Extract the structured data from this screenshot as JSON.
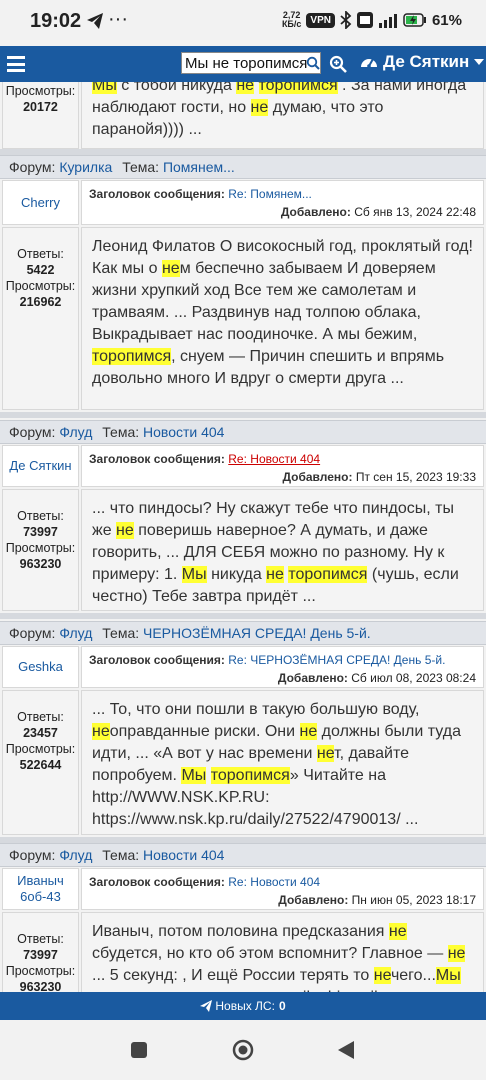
{
  "status_bar": {
    "time": "19:02",
    "speed_value": "2,72",
    "speed_unit": "КБ/с",
    "vpn": "VPN",
    "battery": "61%"
  },
  "header": {
    "search_value": "Мы не торопимся",
    "username": "Де Сяткин"
  },
  "labels": {
    "forum": "Форум:",
    "topic": "Тема:",
    "subject": "Заголовок сообщения:",
    "added": "Добавлено:",
    "replies": "Ответы:",
    "views": "Просмотры:"
  },
  "first_partial": {
    "views_label": "Просмотры:",
    "views": "20172"
  },
  "posts": [
    {
      "forum": "Курилка",
      "topic": "Помянем...",
      "author": "Cherry",
      "subject": "Re: Помянем...",
      "date": "Сб янв 13, 2024 22:48",
      "replies": "5422",
      "views": "216962"
    },
    {
      "forum": "Флуд",
      "topic": "Новости 404",
      "author": "Де Сяткин",
      "subject": "Re: Новости 404",
      "date": "Пт сен 15, 2023 19:33",
      "replies": "73997",
      "views": "963230"
    },
    {
      "forum": "Флуд",
      "topic": "ЧЕРНОЗЁМНАЯ СРЕДА! День 5-й.",
      "author": "Geshka",
      "subject": "Re: ЧЕРНОЗЁМНАЯ СРЕДА! День 5-й.",
      "date": "Сб июл 08, 2023 08:24",
      "replies": "23457",
      "views": "522644"
    },
    {
      "forum": "Флуд",
      "topic": "Новости 404",
      "author": "Иваныч 6об-43",
      "subject": "Re: Новости 404",
      "date": "Пн июн 05, 2023 18:17",
      "replies": "73997",
      "views": "963230"
    }
  ],
  "bottom_bar": {
    "label": "Новых ЛС:",
    "count": "0"
  },
  "colors": {
    "primary": "#1a5aa0",
    "highlight": "#ffff33",
    "link_red": "#cc0000"
  }
}
